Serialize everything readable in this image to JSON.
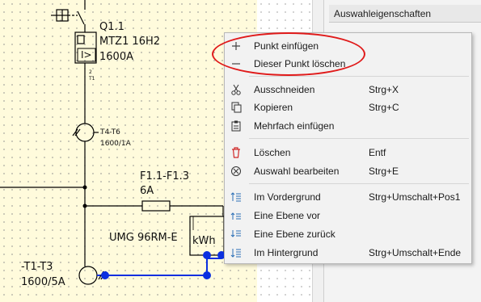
{
  "panel": {
    "header": "Auswahleigenschaften"
  },
  "schematic": {
    "q_name": "Q1.1",
    "q_type": "MTZ1 16H2",
    "q_rating": "1600A",
    "q_symbol": "I>",
    "pin2": "2",
    "pinT1": "T1",
    "ct_top_name": "T4-T6",
    "ct_top_ratio": "1600/1A",
    "fuse_name": "F1.1-F1.3",
    "fuse_rating": "6A",
    "meter_name": "UMG 96RM-E",
    "meter_unit": "kWh",
    "ct_bottom_name": "-T1-T3",
    "ct_bottom_ratio": "1600/5A"
  },
  "menu": {
    "items": [
      {
        "label": "Punkt einfügen",
        "shortcut": "",
        "icon": "plus-icon"
      },
      {
        "label": "Dieser Punkt löschen",
        "shortcut": "",
        "icon": "minus-icon"
      },
      {
        "label": "Ausschneiden",
        "shortcut": "Strg+X",
        "icon": "scissors-icon"
      },
      {
        "label": "Kopieren",
        "shortcut": "Strg+C",
        "icon": "copy-icon"
      },
      {
        "label": "Mehrfach einfügen",
        "shortcut": "",
        "icon": "paste-multiple-icon"
      },
      {
        "label": "Löschen",
        "shortcut": "Entf",
        "icon": "trash-icon"
      },
      {
        "label": "Auswahl bearbeiten",
        "shortcut": "Strg+E",
        "icon": "edit-selection-icon"
      },
      {
        "label": "Im Vordergrund",
        "shortcut": "Strg+Umschalt+Pos1",
        "icon": "bring-to-front-icon"
      },
      {
        "label": "Eine Ebene vor",
        "shortcut": "",
        "icon": "bring-forward-icon"
      },
      {
        "label": "Eine Ebene zurück",
        "shortcut": "",
        "icon": "send-backward-icon"
      },
      {
        "label": "Im Hintergrund",
        "shortcut": "Strg+Umschalt+Ende",
        "icon": "send-to-back-icon"
      }
    ]
  },
  "colors": {
    "highlight": "#e01a1a",
    "handle": "#0a2fe0",
    "canvas": "#fffbdc",
    "trash": "#d02828",
    "layer_icon": "#2b6fb6"
  }
}
